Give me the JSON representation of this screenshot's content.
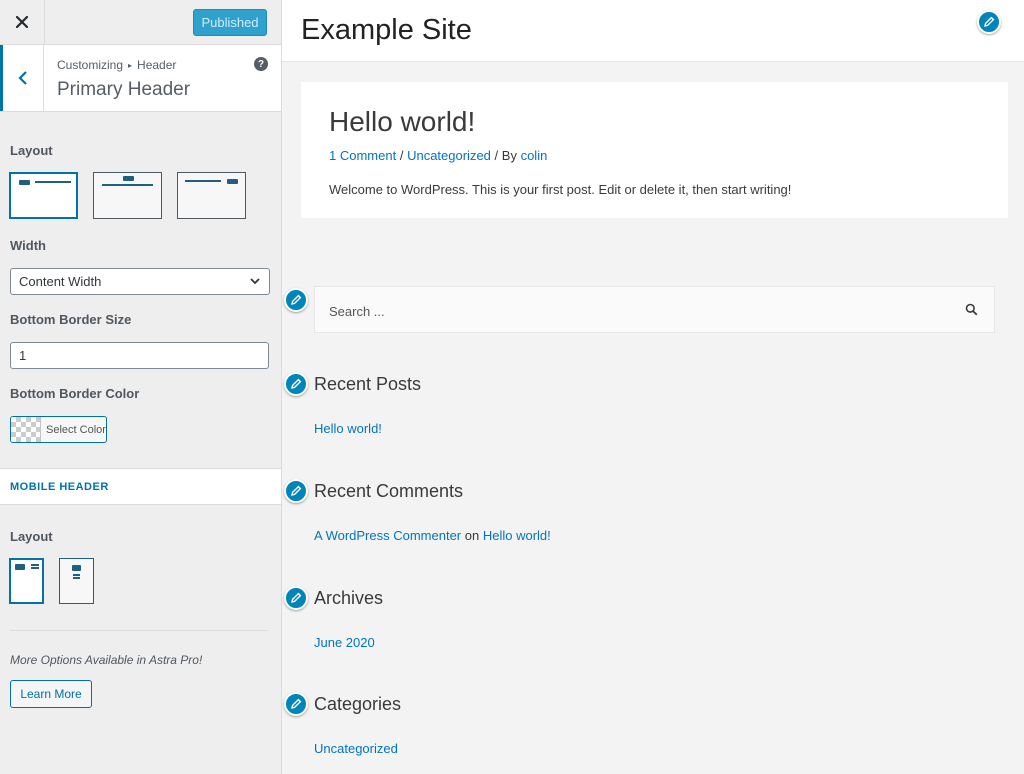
{
  "sidebar": {
    "publish_label": "Published",
    "breadcrumb": {
      "root": "Customizing",
      "parent": "Header"
    },
    "section_title": "Primary Header",
    "layout_label": "Layout",
    "width_label": "Width",
    "width_value": "Content Width",
    "border_size_label": "Bottom Border Size",
    "border_size_value": "1",
    "border_color_label": "Bottom Border Color",
    "select_color_label": "Select Color",
    "mobile_section_label": "MOBILE HEADER",
    "mobile_layout_label": "Layout",
    "more_options_text": "More Options Available in Astra Pro!",
    "learn_more_label": "Learn More"
  },
  "preview": {
    "site_title": "Example Site",
    "post": {
      "title": "Hello world!",
      "comments": "1 Comment",
      "category": "Uncategorized",
      "by": "By",
      "author": "colin",
      "sep": "/",
      "excerpt": "Welcome to WordPress. This is your first post. Edit or delete it, then start writing!"
    },
    "search_placeholder": "Search ...",
    "recent_posts": {
      "title": "Recent Posts",
      "item": "Hello world!"
    },
    "recent_comments": {
      "title": "Recent Comments",
      "author": "A WordPress Commenter",
      "on": "on",
      "post": "Hello world!"
    },
    "archives": {
      "title": "Archives",
      "item": "June 2020"
    },
    "categories": {
      "title": "Categories",
      "item": "Uncategorized"
    }
  },
  "colors": {
    "accent": "#0073aa",
    "publish": "#2ea2cc",
    "link": "#0274be"
  },
  "icons": [
    "close-icon",
    "back-chevron-icon",
    "help-icon",
    "chevron-down-icon",
    "search-icon",
    "pencil-icon"
  ]
}
